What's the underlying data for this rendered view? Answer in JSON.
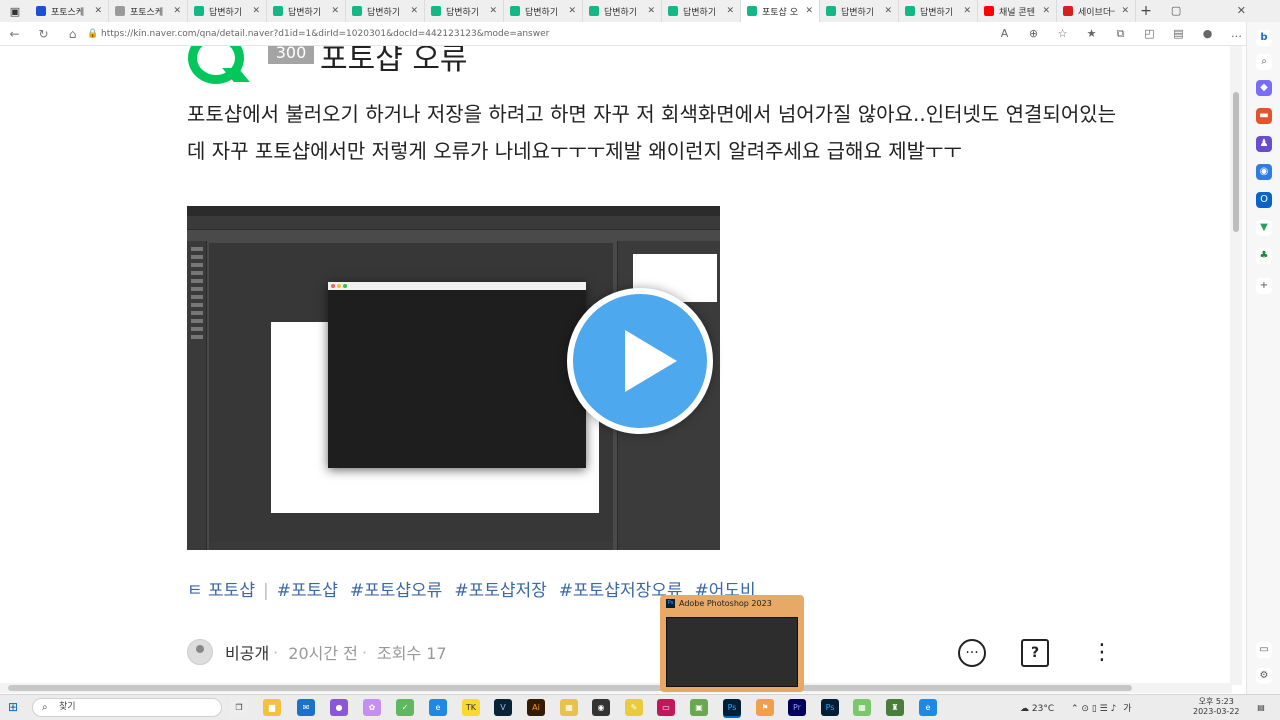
{
  "browser": {
    "tabs": [
      {
        "title": "포토스케",
        "favicon": "#1a4fd6",
        "icon_name": "z-icon"
      },
      {
        "title": "포토스케",
        "favicon": "#9a9a9a",
        "icon_name": "page-icon"
      },
      {
        "title": "답변하기",
        "favicon": "#12b886",
        "icon_name": "naver-kin-icon"
      },
      {
        "title": "답변하기",
        "favicon": "#12b886",
        "icon_name": "naver-kin-icon"
      },
      {
        "title": "답변하기",
        "favicon": "#12b886",
        "icon_name": "naver-kin-icon"
      },
      {
        "title": "답변하기",
        "favicon": "#12b886",
        "icon_name": "naver-kin-icon"
      },
      {
        "title": "답변하기",
        "favicon": "#12b886",
        "icon_name": "naver-kin-icon"
      },
      {
        "title": "답변하기",
        "favicon": "#12b886",
        "icon_name": "naver-kin-icon"
      },
      {
        "title": "답변하기",
        "favicon": "#12b886",
        "icon_name": "naver-kin-icon"
      },
      {
        "title": "포토샵 오",
        "favicon": "#12b886",
        "icon_name": "naver-kin-icon",
        "active": true
      },
      {
        "title": "답변하기",
        "favicon": "#12b886",
        "icon_name": "naver-kin-icon"
      },
      {
        "title": "답변하기",
        "favicon": "#12b886",
        "icon_name": "naver-kin-icon"
      },
      {
        "title": "채널 콘텐",
        "favicon": "#ff0000",
        "icon_name": "youtube-icon"
      },
      {
        "title": "세이브더",
        "favicon": "#d42020",
        "icon_name": "savethechildren-icon"
      }
    ],
    "url": "https://kin.naver.com/qna/detail.naver?d1id=1&dirId=1020301&docId=442123123&mode=answer"
  },
  "question": {
    "points": "300",
    "title": "포토샵 오류",
    "body": "포토샵에서 불러오기 하거나 저장을 하려고 하면 자꾸 저 회색화면에서 넘어가질 않아요..인터넷도 연결되어있는데 자꾸 포토샵에서만 저렇게 오류가 나네요ㅜㅜㅜ제발 왜이런지 알려주세요 급해요 제발ㅜㅜ",
    "tags_prefix": "ㅌ 포토샵",
    "tags": [
      "#포토샵",
      "#포토샵오류",
      "#포토샵저장",
      "#포토샵저장오류",
      "#어도비"
    ],
    "author": "비공개",
    "time": "20시간 전",
    "views": "조회수 17"
  },
  "taskbar": {
    "search_placeholder": "찾기",
    "preview_title": "Adobe Photoshop 2023",
    "weather": "23°C",
    "ime": "가",
    "ampm_time": "오후 5:23",
    "date": "2023-03-22"
  },
  "colors": {
    "naver_green": "#03c75a",
    "play_blue": "#4ea8ed",
    "tag_blue": "#3a68a8"
  }
}
